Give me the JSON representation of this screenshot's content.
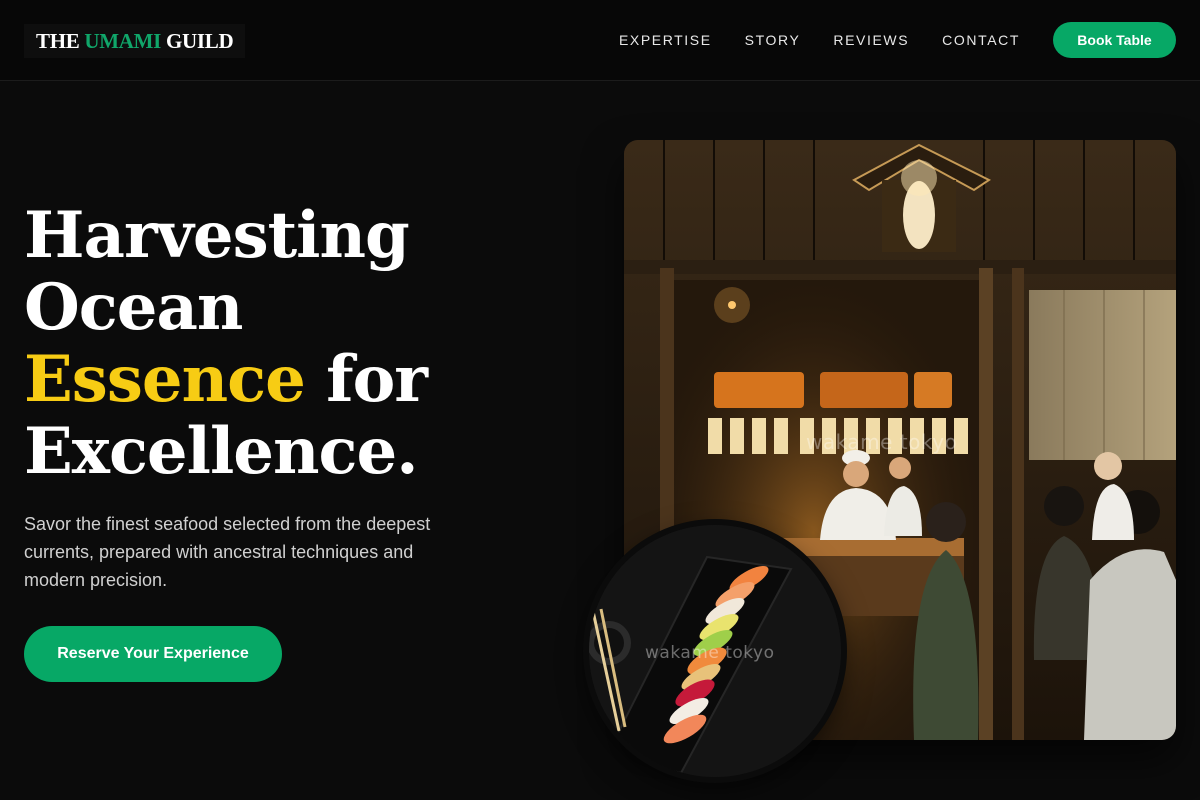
{
  "brand": {
    "name_1": "THE ",
    "name_accent": "UMAMI",
    "name_2": " GUILD",
    "accent_color": "#10a66a"
  },
  "nav": {
    "items": [
      "EXPERTISE",
      "STORY",
      "REVIEWS",
      "CONTACT"
    ],
    "cta": "Book Table"
  },
  "hero": {
    "headline_1": "Harvesting",
    "headline_2": "Ocean",
    "headline_highlight": "Essence",
    "headline_3": " for",
    "headline_4": "Excellence.",
    "highlight_color": "#f7cc14",
    "subtext": "Savor the finest seafood selected from the deepest currents, prepared with ancestral techniques and modern precision.",
    "cta": "Reserve Your Experience",
    "photo_watermark": "wakame tokyo",
    "sushi_watermark": "wakame tokyo"
  },
  "colors": {
    "primary_green": "#07a866",
    "background": "#0b0b0b"
  }
}
